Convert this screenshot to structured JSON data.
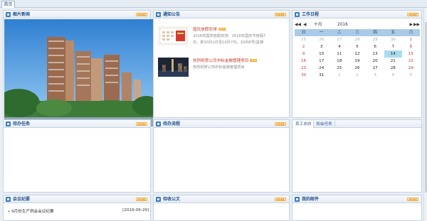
{
  "tab": {
    "label": "首页"
  },
  "more_label": "MORE",
  "photo_news": {
    "title": "图片新闻",
    "carousel_dots": 3,
    "active_dot": 2
  },
  "notices": {
    "title": "通知公告",
    "items": [
      {
        "title": "国庆放假安排",
        "badge": "NEW",
        "desc1": "2016年国庆放假安排：2016年国庆节放假7",
        "desc2": "天，即10月1日至10月7日。10月8号(星期"
      },
      {
        "title": "热烈祝贺公司中标金融管理项目",
        "badge": "NEW",
        "desc1": "热烈祝贺公司中标金融管理项目",
        "desc2": ""
      }
    ]
  },
  "schedule": {
    "title": "工作日程",
    "calendar": {
      "month": "十月",
      "year": "2016",
      "weekdays": [
        "日",
        "一",
        "二",
        "三",
        "四",
        "五",
        "六"
      ],
      "weeks": [
        [
          "25",
          "26",
          "27",
          "28",
          "29",
          "30",
          "1"
        ],
        [
          "2",
          "3",
          "4",
          "5",
          "6",
          "7",
          "8"
        ],
        [
          "9",
          "10",
          "11",
          "12",
          "13",
          "14",
          "15"
        ],
        [
          "16",
          "17",
          "18",
          "19",
          "20",
          "21",
          "22"
        ],
        [
          "23",
          "24",
          "25",
          "26",
          "27",
          "28",
          "29"
        ],
        [
          "30",
          "31",
          "1",
          "2",
          "3",
          "4",
          "5"
        ]
      ],
      "today": "14"
    }
  },
  "todo_tasks": {
    "title": "待办任务"
  },
  "todo_process": {
    "title": "待办流程"
  },
  "staff_tabs": {
    "tabs": [
      "员工去向",
      "知会任务"
    ]
  },
  "meeting": {
    "title": "会议纪要",
    "items": [
      {
        "text": "9月份生产例会会议纪要",
        "date": "[2016-09-29]"
      }
    ]
  },
  "todo_docs": {
    "title": "待收公文"
  },
  "mail": {
    "title": "我的邮件"
  }
}
